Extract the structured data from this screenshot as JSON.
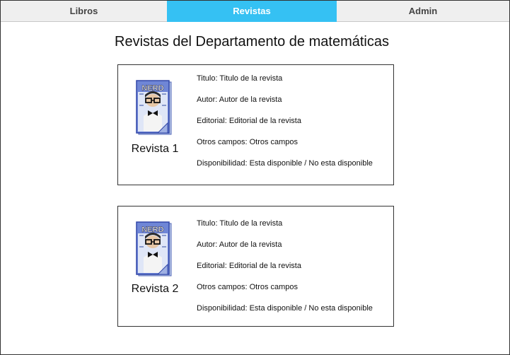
{
  "tabs": [
    {
      "label": "Libros",
      "active": false
    },
    {
      "label": "Revistas",
      "active": true
    },
    {
      "label": "Admin",
      "active": false
    }
  ],
  "page_title": "Revistas del Departamento de matemáticas",
  "colors": {
    "active_tab": "#35c1f3",
    "inactive_tab": "#efefef",
    "border": "#333333"
  },
  "magazines": [
    {
      "name": "Revista 1",
      "cover_icon": "nerd-magazine-cover-icon",
      "cover_text": "NERD",
      "fields": [
        "Titulo: Titulo de la revista",
        "Autor: Autor de la revista",
        "Editorial: Editorial de la revista",
        "Otros campos: Otros campos",
        "Disponibilidad: Esta disponible / No esta disponible"
      ]
    },
    {
      "name": "Revista 2",
      "cover_icon": "nerd-magazine-cover-icon",
      "cover_text": "NERD",
      "fields": [
        "Titulo: Titulo de la revista",
        "Autor: Autor de la revista",
        "Editorial: Editorial de la revista",
        "Otros campos: Otros campos",
        "Disponibilidad: Esta disponible / No esta disponible"
      ]
    }
  ]
}
